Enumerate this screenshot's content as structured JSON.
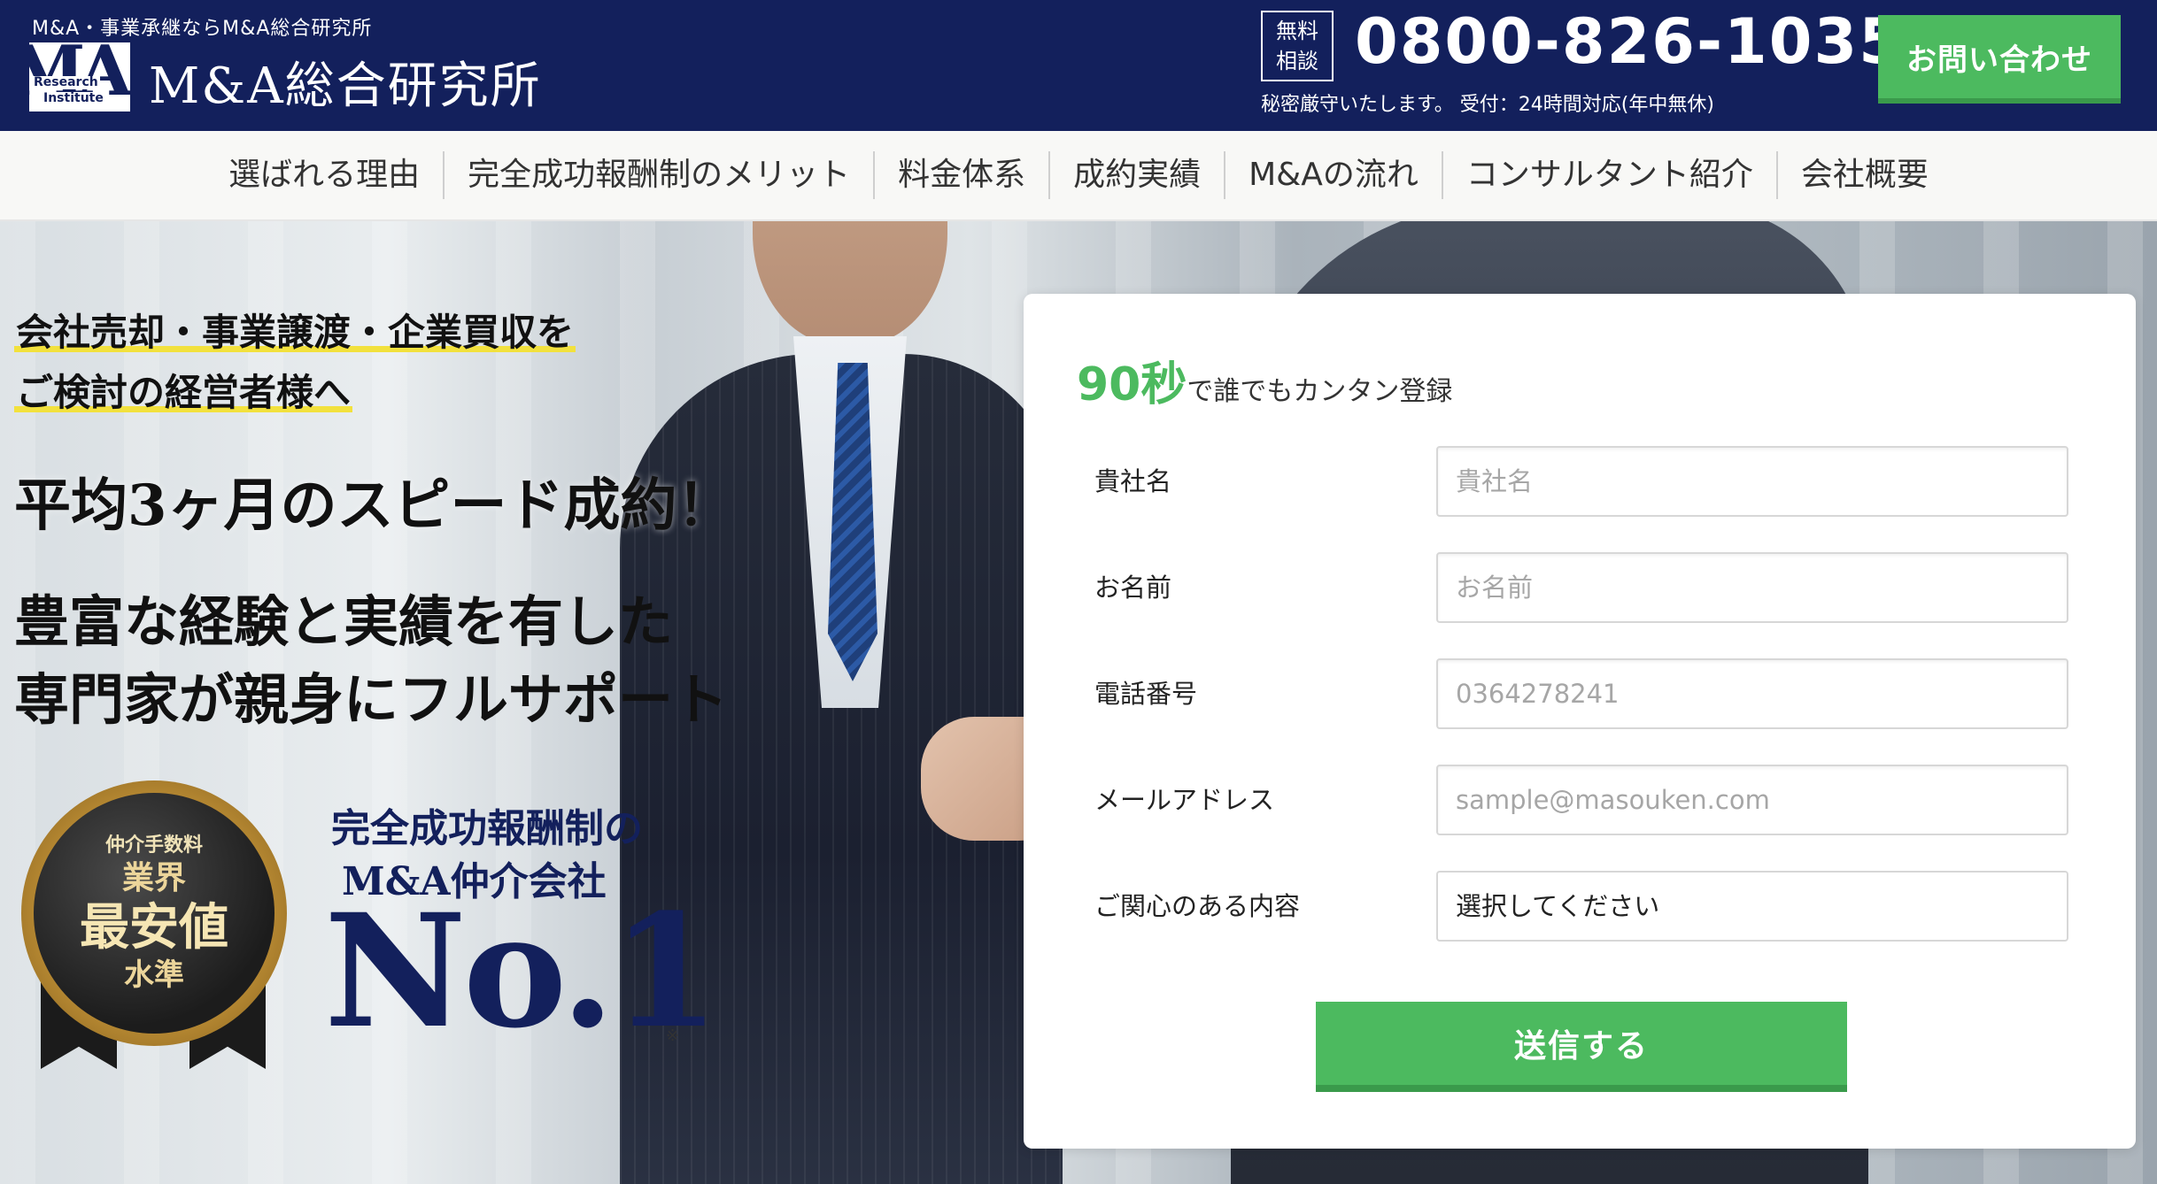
{
  "header": {
    "tagline": "M&A・事業承継ならM&A総合研究所",
    "logo_mark": {
      "letters": "MA",
      "research": "Research",
      "institute": "Institute"
    },
    "logo_text": "M&A総合研究所",
    "free_badge_line1": "無料",
    "free_badge_line2": "相談",
    "phone": "0800-826-1035",
    "phone_note": "秘密厳守いたします。 受付：24時間対応(年中無休)",
    "contact_button": "お問い合わせ"
  },
  "nav": {
    "items": [
      {
        "label": "選ばれる理由"
      },
      {
        "label": "完全成功報酬制のメリット"
      },
      {
        "label": "料金体系"
      },
      {
        "label": "成約実績"
      },
      {
        "label": "M&Aの流れ"
      },
      {
        "label": "コンサルタント紹介"
      },
      {
        "label": "会社概要"
      }
    ]
  },
  "hero": {
    "highlight_line1": "会社売却・事業譲渡・企業買収を",
    "highlight_line2": "ご検討の経営者様へ",
    "headline": "平均3ヶ月のスピード成約！",
    "sub_line1": "豊富な経験と実績を有した",
    "sub_line2": "専門家が親身にフルサポート",
    "medal": {
      "line1": "仲介手数料",
      "line2": "業界",
      "line3": "最安値",
      "line4": "水準"
    },
    "no1_label_line1": "完全成功報酬制の",
    "no1_label_line2": "M&A仲介会社",
    "no1": "No.1",
    "no1_mark": "※"
  },
  "form": {
    "lead_big": "90秒",
    "lead_small": "で誰でもカンタン登録",
    "fields": [
      {
        "label": "貴社名",
        "placeholder": "貴社名"
      },
      {
        "label": "お名前",
        "placeholder": "お名前"
      },
      {
        "label": "電話番号",
        "placeholder": "0364278241"
      },
      {
        "label": "メールアドレス",
        "placeholder": "sample@masouken.com"
      }
    ],
    "interest_label": "ご関心のある内容",
    "interest_selected": "選択してください",
    "submit": "送信する"
  },
  "colors": {
    "header_bg": "#13205c",
    "accent_green": "#4cba5f",
    "highlight_yellow": "#f2e13d",
    "navy_text": "#13205c"
  }
}
